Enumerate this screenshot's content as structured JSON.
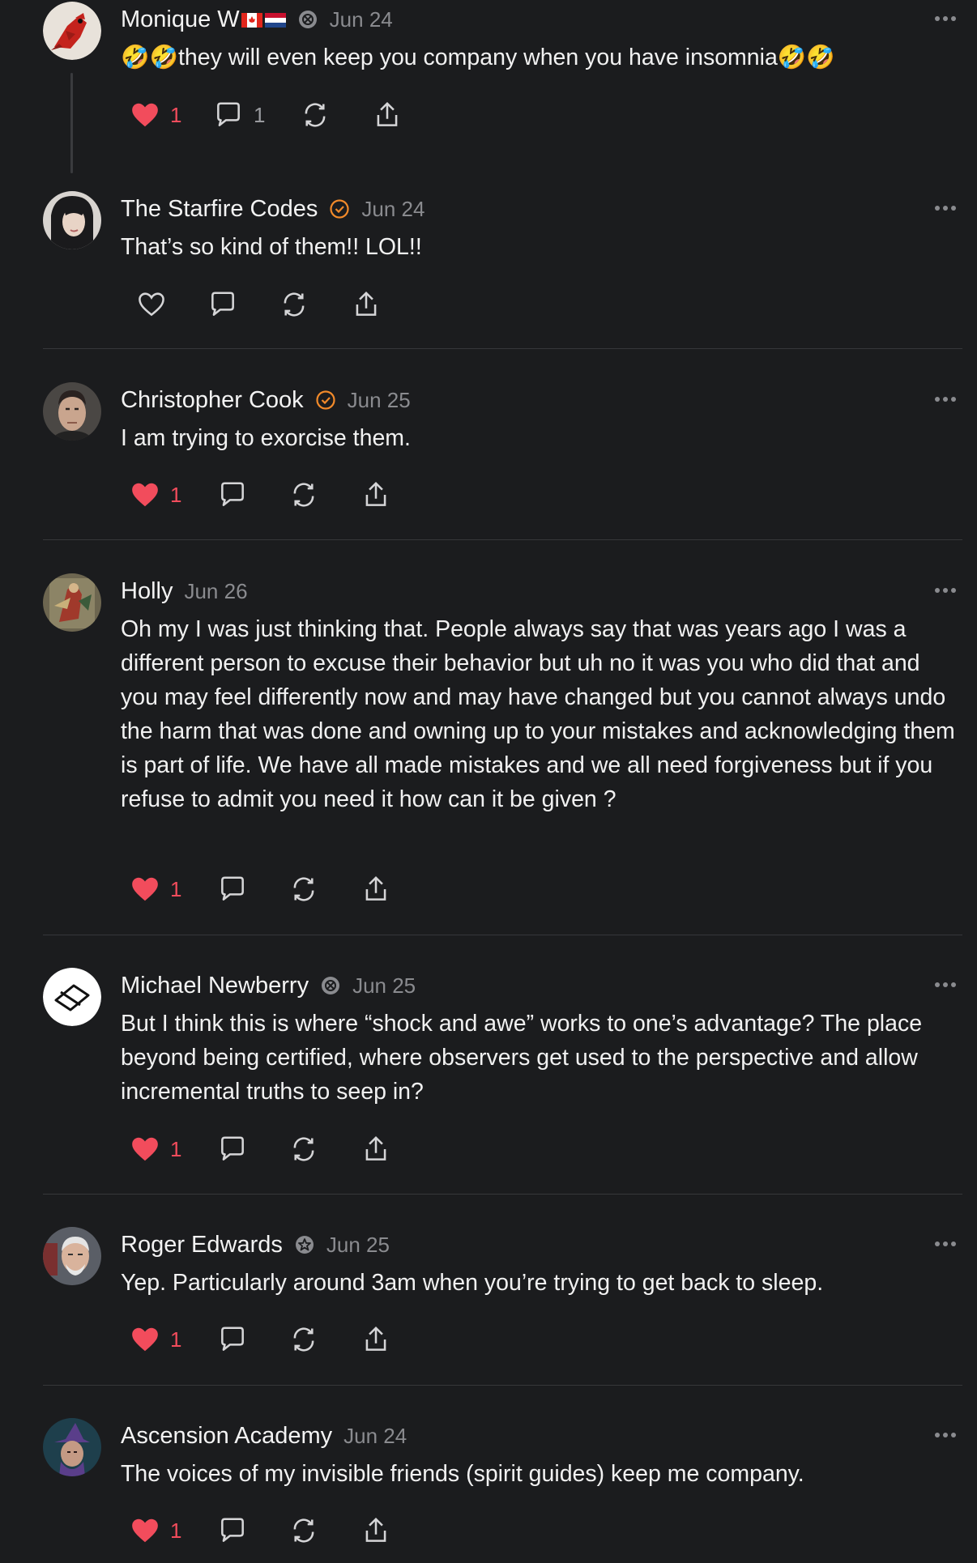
{
  "colors": {
    "background": "#1b1c1e",
    "liked_red": "#f24c5c",
    "verified_orange": "#f28a2a",
    "muted_text": "#8a8b8f"
  },
  "posts": [
    {
      "author": "Monique W",
      "badge": "community-badge-icon",
      "date": "Jun 24",
      "text": "🤣🤣they will even keep you company when you have insomnia🤣🤣",
      "likes": "1",
      "comments": "1",
      "liked": true
    },
    {
      "author": "The Starfire Codes",
      "badge": "verified-check-icon",
      "date": "Jun 24",
      "text": "That’s so kind of them!! LOL!!",
      "likes": "",
      "comments": "",
      "liked": false
    },
    {
      "author": "Christopher Cook",
      "badge": "verified-check-icon",
      "date": "Jun 25",
      "text": "I am trying to exorcise them.",
      "likes": "1",
      "comments": "",
      "liked": true
    },
    {
      "author": "Holly",
      "badge": "",
      "date": "Jun 26",
      "text": "Oh my I was just thinking that. People always say that was years ago I was a different person to excuse their behavior but uh no it was you who did that and you may feel differently now and may have changed but you cannot always undo the harm that was done and owning up to your mistakes and acknowledging them is part of life. We have all made mistakes and we all need forgiveness but if you refuse to admit you need it how can it be given ?",
      "likes": "1",
      "comments": "",
      "liked": true
    },
    {
      "author": "Michael Newberry",
      "badge": "community-badge-icon",
      "date": "Jun 25",
      "text": "But I think this is where “shock and awe” works to one’s advantage? The place beyond being certified, where observers get used to the perspective and allow incremental truths to seep in?",
      "likes": "1",
      "comments": "",
      "liked": true
    },
    {
      "author": "Roger Edwards",
      "badge": "community-badge-icon",
      "date": "Jun 25",
      "text": "Yep. Particularly around 3am when you’re trying to get back to sleep.",
      "likes": "1",
      "comments": "",
      "liked": true
    },
    {
      "author": "Ascension Academy",
      "badge": "",
      "date": "Jun 24",
      "text": "The voices of my invisible friends (spirit guides) keep me company.",
      "likes": "1",
      "comments": "",
      "liked": true
    }
  ]
}
